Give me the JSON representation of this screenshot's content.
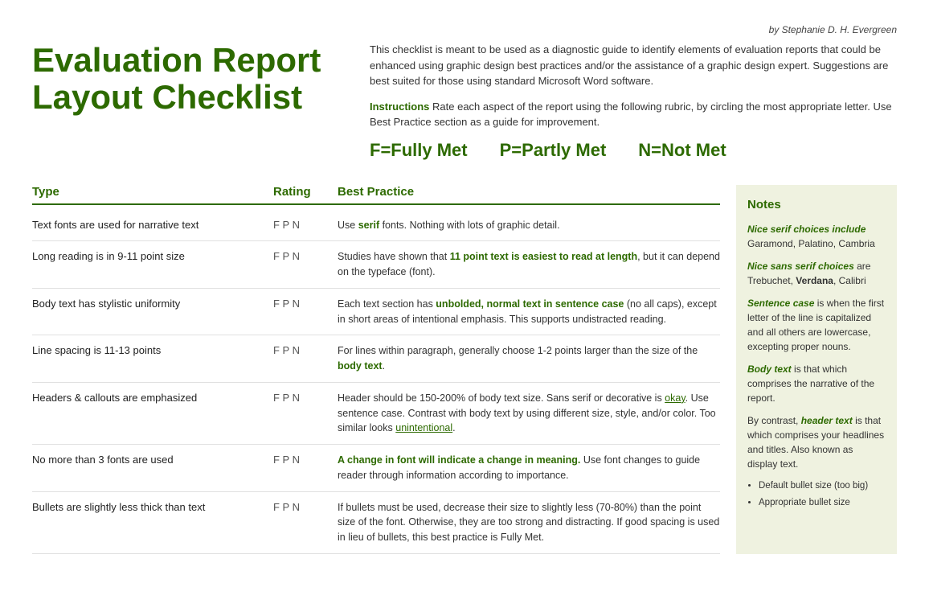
{
  "byline": "by Stephanie D. H. Evergreen",
  "title": "Evaluation Report Layout Checklist",
  "intro": {
    "paragraph1": "This checklist is meant to be used as a diagnostic guide to identify elements of evaluation reports that could be enhanced using graphic design best practices and/or the assistance of a graphic design expert. Suggestions are best suited for those using standard Microsoft Word software.",
    "instructions_label": "Instructions",
    "instructions_text": " Rate each aspect of the report using the following rubric, by circling the most appropriate letter. Use Best Practice section as a guide for improvement."
  },
  "ratings": {
    "fully_met": "F=Fully Met",
    "partly_met": "P=Partly Met",
    "not_met": "N=Not Met"
  },
  "table": {
    "headers": {
      "type": "Type",
      "rating": "Rating",
      "best_practice": "Best Practice"
    },
    "rows": [
      {
        "type": "Text fonts are used for narrative text",
        "rating": "F   P   N",
        "best_practice": "Use serif fonts. Nothing with lots of graphic detail."
      },
      {
        "type": "Long reading is in 9-11 point size",
        "rating": "F   P   N",
        "best_practice": "Studies have shown that 11 point text is easiest to read at length, but it can depend on the typeface (font)."
      },
      {
        "type": "Body text has stylistic uniformity",
        "rating": "F   P   N",
        "best_practice": "Each text section has unbolded, normal text in sentence case (no all caps), except in short areas of intentional emphasis. This supports undistracted reading."
      },
      {
        "type": "Line spacing is 11-13 points",
        "rating": "F   P   N",
        "best_practice": "For lines within paragraph, generally choose 1-2 points larger than the size of the body text."
      },
      {
        "type": "Headers & callouts are emphasized",
        "rating": "F   P   N",
        "best_practice": "Header should be 150-200% of body text size. Sans serif or decorative is okay. Use sentence case. Contrast with body text by using different size, style, and/or color. Too similar looks unintentional."
      },
      {
        "type": "No more than 3 fonts are used",
        "rating": "F   P   N",
        "best_practice": "A change in font will indicate a change in meaning. Use font changes to guide reader through information according to importance."
      },
      {
        "type": "Bullets are slightly less thick than text",
        "rating": "F   P   N",
        "best_practice": "If bullets must be used, decrease their size to slightly less (70-80%) than the point size of the font. Otherwise, they are too strong and distracting. If good spacing is used in lieu of bullets, this best practice is Fully Met."
      }
    ]
  },
  "notes": {
    "title": "Notes",
    "items": [
      {
        "italic_label": "Nice serif choices include",
        "text": " Garamond, Palatino, Cambria"
      },
      {
        "italic_label": "Nice sans serif choices",
        "text": " are Trebuchet, ",
        "bold_part": "Verdana",
        "text2": ", Calibri"
      },
      {
        "italic_label": "Sentence case",
        "text": " is when the first letter of the line is capitalized and all others are lowercase, excepting proper nouns."
      },
      {
        "italic_label": "Body text",
        "text": " is that which comprises the narrative of the report."
      },
      {
        "text": "By contrast, ",
        "italic_label": "header text",
        "text2": " is that which comprises your headlines and titles. Also known as display text."
      },
      {
        "bullets": [
          "Default bullet size (too big)",
          "Appropriate bullet size"
        ]
      }
    ]
  }
}
